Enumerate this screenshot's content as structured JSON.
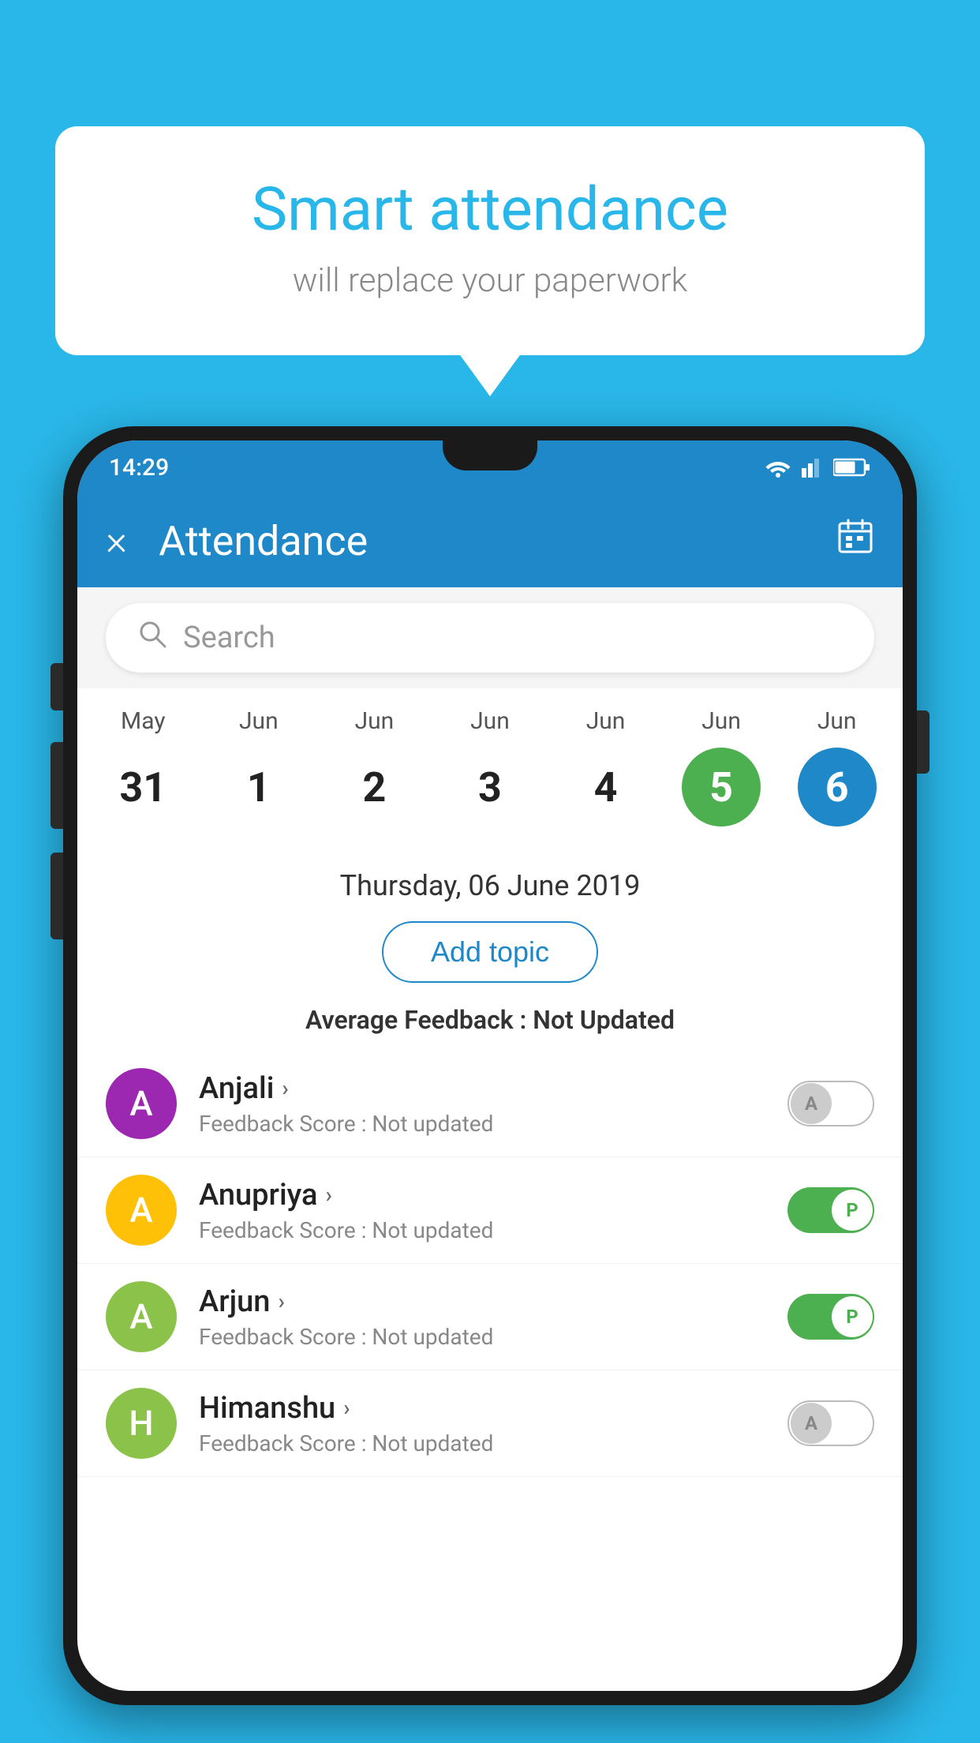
{
  "background_color": "#29B6E8",
  "bubble": {
    "title": "Smart attendance",
    "subtitle": "will replace your paperwork"
  },
  "status_bar": {
    "time": "14:29"
  },
  "app_bar": {
    "title": "Attendance",
    "close_label": "×"
  },
  "search": {
    "placeholder": "Search"
  },
  "calendar": {
    "days": [
      {
        "month": "May",
        "date": "31",
        "style": "normal"
      },
      {
        "month": "Jun",
        "date": "1",
        "style": "normal"
      },
      {
        "month": "Jun",
        "date": "2",
        "style": "normal"
      },
      {
        "month": "Jun",
        "date": "3",
        "style": "normal"
      },
      {
        "month": "Jun",
        "date": "4",
        "style": "normal"
      },
      {
        "month": "Jun",
        "date": "5",
        "style": "green"
      },
      {
        "month": "Jun",
        "date": "6",
        "style": "blue"
      }
    ]
  },
  "selected_date": "Thursday, 06 June 2019",
  "add_topic_label": "Add topic",
  "avg_feedback_label": "Average Feedback :",
  "avg_feedback_value": "Not Updated",
  "students": [
    {
      "name": "Anjali",
      "avatar_letter": "A",
      "avatar_color": "#9C27B0",
      "feedback_label": "Feedback Score :",
      "feedback_value": "Not updated",
      "toggle": "off",
      "toggle_letter": "A"
    },
    {
      "name": "Anupriya",
      "avatar_letter": "A",
      "avatar_color": "#FFC107",
      "feedback_label": "Feedback Score :",
      "feedback_value": "Not updated",
      "toggle": "on",
      "toggle_letter": "P"
    },
    {
      "name": "Arjun",
      "avatar_letter": "A",
      "avatar_color": "#8BC34A",
      "feedback_label": "Feedback Score :",
      "feedback_value": "Not updated",
      "toggle": "on",
      "toggle_letter": "P"
    },
    {
      "name": "Himanshu",
      "avatar_letter": "H",
      "avatar_color": "#8BC34A",
      "feedback_label": "Feedback Score :",
      "feedback_value": "Not updated",
      "toggle": "off",
      "toggle_letter": "A"
    }
  ]
}
